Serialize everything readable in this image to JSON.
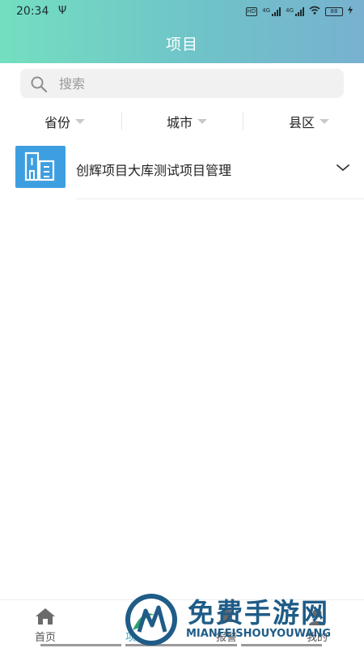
{
  "status_bar": {
    "time": "20:34",
    "network_1": "4G",
    "network_2": "4G",
    "hd_badge": "HD",
    "battery": "88"
  },
  "header": {
    "title": "项目"
  },
  "search": {
    "placeholder": "搜索",
    "value": ""
  },
  "filters": [
    {
      "label": "省份"
    },
    {
      "label": "城市"
    },
    {
      "label": "县区"
    }
  ],
  "projects": [
    {
      "name": "创辉项目大库测试项目管理",
      "icon": "building-icon",
      "icon_color": "#3e9fe0"
    }
  ],
  "tabbar": {
    "active_index": 1,
    "active_color": "#3aa8c9",
    "tabs": [
      {
        "label": "首页",
        "icon": "home-icon"
      },
      {
        "label": "项目",
        "icon": "project-icon"
      },
      {
        "label": "报警",
        "icon": "alarm-icon"
      },
      {
        "label": "我的",
        "icon": "user-icon"
      }
    ]
  },
  "watermark": {
    "text": "免费手游网",
    "subtext": "MIANFEISHOUYOUWANG"
  },
  "colors": {
    "header_start": "#74dfc0",
    "header_end": "#78b1cf",
    "accent": "#3e9fe0"
  }
}
